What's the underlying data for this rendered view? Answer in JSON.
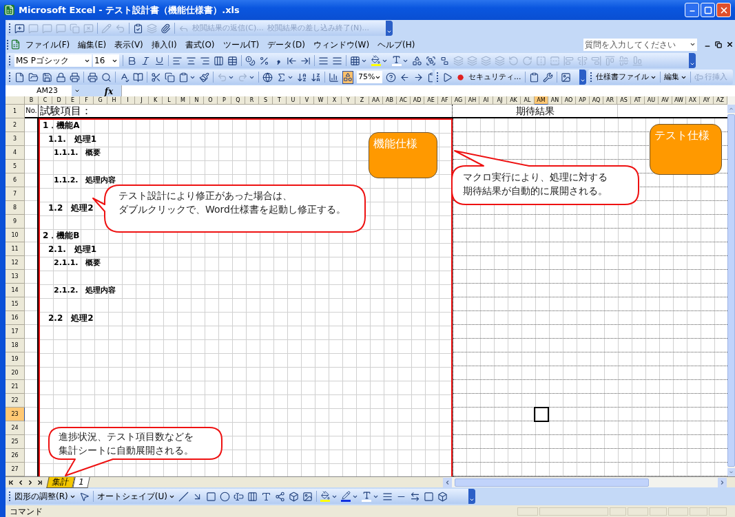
{
  "window": {
    "title": "Microsoft Excel - テスト設計書（機能仕様書）.xls"
  },
  "review_toolbar": {
    "items": [
      {
        "label": "校閲結果の返信(C)...",
        "disabled": true
      },
      {
        "label": "校閲結果の差し込み終了(N)...",
        "disabled": true
      }
    ]
  },
  "menu_bar": {
    "items": [
      "ファイル(F)",
      "編集(E)",
      "表示(V)",
      "挿入(I)",
      "書式(O)",
      "ツール(T)",
      "データ(D)",
      "ウィンドウ(W)",
      "ヘルプ(H)"
    ]
  },
  "help_search": {
    "placeholder": "質問を入力してください"
  },
  "formatting_toolbar": {
    "font": "MS Pゴシック",
    "size": "16"
  },
  "standard_toolbar": {
    "zoom": "75%"
  },
  "macro_toolbar": {
    "security": "セキュリティ..."
  },
  "custom_toolbar": {
    "items": [
      {
        "label": "仕様書ファイル",
        "kind": "menu",
        "disabled": false
      },
      {
        "label": "編集",
        "kind": "menu",
        "disabled": false
      },
      {
        "label": "行挿入",
        "kind": "button",
        "disabled": true
      }
    ]
  },
  "formula_bar": {
    "name_box": "AM23",
    "function_label": "fx"
  },
  "columns": [
    {
      "label": "B",
      "selected": false
    },
    {
      "label": "C",
      "selected": false
    },
    {
      "label": "D",
      "selected": false
    },
    {
      "label": "E",
      "selected": false
    },
    {
      "label": "F",
      "selected": false
    },
    {
      "label": "G",
      "selected": false
    },
    {
      "label": "H",
      "selected": false
    },
    {
      "label": "I",
      "selected": false
    },
    {
      "label": "J",
      "selected": false
    },
    {
      "label": "K",
      "selected": false
    },
    {
      "label": "L",
      "selected": false
    },
    {
      "label": "M",
      "selected": false
    },
    {
      "label": "N",
      "selected": false
    },
    {
      "label": "O",
      "selected": false
    },
    {
      "label": "P",
      "selected": false
    },
    {
      "label": "Q",
      "selected": false
    },
    {
      "label": "R",
      "selected": false
    },
    {
      "label": "S",
      "selected": false
    },
    {
      "label": "T",
      "selected": false
    },
    {
      "label": "U",
      "selected": false
    },
    {
      "label": "V",
      "selected": false
    },
    {
      "label": "W",
      "selected": false
    },
    {
      "label": "X",
      "selected": false
    },
    {
      "label": "Y",
      "selected": false
    },
    {
      "label": "Z",
      "selected": false
    },
    {
      "label": "AA",
      "selected": false
    },
    {
      "label": "AB",
      "selected": false
    },
    {
      "label": "AC",
      "selected": false
    },
    {
      "label": "AD",
      "selected": false
    },
    {
      "label": "AE",
      "selected": false
    },
    {
      "label": "AF",
      "selected": false
    },
    {
      "label": "AG",
      "selected": false
    },
    {
      "label": "AH",
      "selected": false
    },
    {
      "label": "AI",
      "selected": false
    },
    {
      "label": "AJ",
      "selected": false
    },
    {
      "label": "AK",
      "selected": false
    },
    {
      "label": "AL",
      "selected": false
    },
    {
      "label": "AM",
      "selected": true
    },
    {
      "label": "AN",
      "selected": false
    },
    {
      "label": "AO",
      "selected": false
    },
    {
      "label": "AP",
      "selected": false
    },
    {
      "label": "AQ",
      "selected": false
    },
    {
      "label": "AR",
      "selected": false
    },
    {
      "label": "AS",
      "selected": false
    },
    {
      "label": "AT",
      "selected": false
    },
    {
      "label": "AU",
      "selected": false
    },
    {
      "label": "AV",
      "selected": false
    },
    {
      "label": "AW",
      "selected": false
    },
    {
      "label": "AX",
      "selected": false
    },
    {
      "label": "AY",
      "selected": false
    },
    {
      "label": "AZ",
      "selected": false
    }
  ],
  "rows": [
    {
      "label": "1",
      "selected": false
    },
    {
      "label": "2",
      "selected": false
    },
    {
      "label": "3",
      "selected": false
    },
    {
      "label": "4",
      "selected": false
    },
    {
      "label": "5",
      "selected": false
    },
    {
      "label": "6",
      "selected": false
    },
    {
      "label": "7",
      "selected": false
    },
    {
      "label": "8",
      "selected": false
    },
    {
      "label": "9",
      "selected": false
    },
    {
      "label": "10",
      "selected": false
    },
    {
      "label": "11",
      "selected": false
    },
    {
      "label": "12",
      "selected": false
    },
    {
      "label": "13",
      "selected": false
    },
    {
      "label": "14",
      "selected": false
    },
    {
      "label": "15",
      "selected": false
    },
    {
      "label": "16",
      "selected": false
    },
    {
      "label": "17",
      "selected": false
    },
    {
      "label": "18",
      "selected": false
    },
    {
      "label": "19",
      "selected": false
    },
    {
      "label": "20",
      "selected": false
    },
    {
      "label": "21",
      "selected": false
    },
    {
      "label": "22",
      "selected": false
    },
    {
      "label": "23",
      "selected": true
    },
    {
      "label": "24",
      "selected": false
    },
    {
      "label": "25",
      "selected": false
    },
    {
      "label": "26",
      "selected": false
    },
    {
      "label": "27",
      "selected": false
    }
  ],
  "header_row": {
    "no": "No.",
    "items": "試験項目：",
    "expected": "期待結果"
  },
  "outline": [
    {
      "label": "1．機能A",
      "children": [
        {
          "label": "1.1.　処理1",
          "children": [
            {
              "label": "1.1.1.　概要"
            },
            {
              "label": "1.1.2.　処理内容"
            }
          ]
        },
        {
          "label": "1.2　処理2"
        }
      ]
    },
    {
      "label": "2．機能B",
      "children": [
        {
          "label": "2.1.　処理1",
          "children": [
            {
              "label": "2.1.1.　概要"
            },
            {
              "label": "2.1.2.　処理内容"
            }
          ]
        },
        {
          "label": "2.2　処理2"
        }
      ]
    }
  ],
  "shapes": [
    {
      "kind": "box",
      "text": "機能仕様"
    },
    {
      "kind": "box",
      "text": "テスト仕様"
    },
    {
      "kind": "callout",
      "lines": [
        "テスト設計により修正があった場合は、",
        "ダブルクリックで、Word仕様書を起動し修正する。"
      ]
    },
    {
      "kind": "callout",
      "lines": [
        "マクロ実行により、処理に対する",
        "期待結果が自動的に展開される。"
      ]
    },
    {
      "kind": "callout",
      "lines": [
        "進捗状況、テスト項目数などを",
        "集計シートに自動展開される。"
      ]
    }
  ],
  "sheet_tabs": [
    {
      "label": "集計",
      "selected": true
    },
    {
      "label": "1",
      "selected": false
    }
  ],
  "drawing_toolbar": {
    "draw_menu": "図形の調整(R)",
    "autoshapes": "オートシェイプ(U)"
  },
  "status_bar": {
    "text": "コマンド"
  }
}
